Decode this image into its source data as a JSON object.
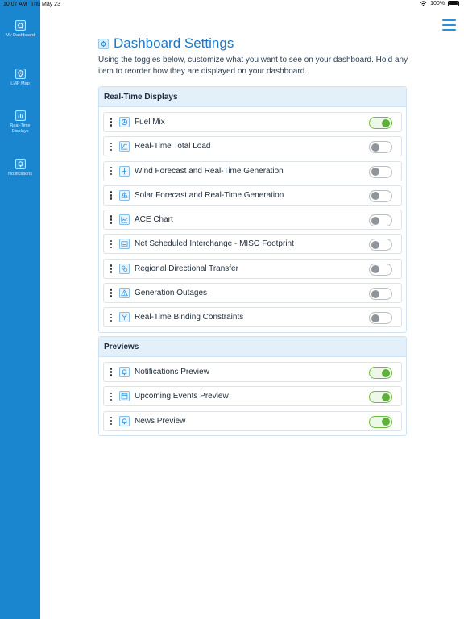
{
  "status_bar": {
    "time": "10:07 AM",
    "date": "Thu May 23",
    "battery": "100%"
  },
  "sidebar": {
    "items": [
      {
        "label": "My Dashboard",
        "icon": "home-icon"
      },
      {
        "label": "LMP Map",
        "icon": "map-pin-icon"
      },
      {
        "label": "Real-Time Displays",
        "icon": "bar-chart-icon"
      },
      {
        "label": "Notifications",
        "icon": "bell-icon"
      }
    ]
  },
  "page": {
    "title": "Dashboard Settings",
    "intro": "Using the toggles below, customize what you want to see on your dashboard. Hold any item to reorder how they are displayed on your dashboard."
  },
  "sections": [
    {
      "title": "Real-Time Displays",
      "items": [
        {
          "label": "Fuel Mix",
          "icon": "fuel-mix-icon",
          "enabled": true
        },
        {
          "label": "Real-Time Total Load",
          "icon": "load-chart-icon",
          "enabled": false
        },
        {
          "label": "Wind Forecast and Real-Time Generation",
          "icon": "wind-turbine-icon",
          "enabled": false
        },
        {
          "label": "Solar Forecast and Real-Time Generation",
          "icon": "solar-panel-icon",
          "enabled": false
        },
        {
          "label": "ACE Chart",
          "icon": "line-chart-icon",
          "enabled": false
        },
        {
          "label": "Net Scheduled Interchange - MISO Footprint",
          "icon": "interchange-icon",
          "enabled": false
        },
        {
          "label": "Regional Directional Transfer",
          "icon": "transfer-icon",
          "enabled": false
        },
        {
          "label": "Generation Outages",
          "icon": "warning-icon",
          "enabled": false
        },
        {
          "label": "Real-Time Binding Constraints",
          "icon": "constraint-icon",
          "enabled": false
        }
      ]
    },
    {
      "title": "Previews",
      "items": [
        {
          "label": "Notifications Preview",
          "icon": "bell-icon",
          "enabled": true
        },
        {
          "label": "Upcoming Events Preview",
          "icon": "calendar-icon",
          "enabled": true
        },
        {
          "label": "News Preview",
          "icon": "bell-icon",
          "enabled": true
        }
      ]
    }
  ],
  "colors": {
    "sidebar": "#1a86d0",
    "accent": "#1f76c4",
    "toggle_on": "#5db03b",
    "section_header": "#e3f0fa"
  }
}
